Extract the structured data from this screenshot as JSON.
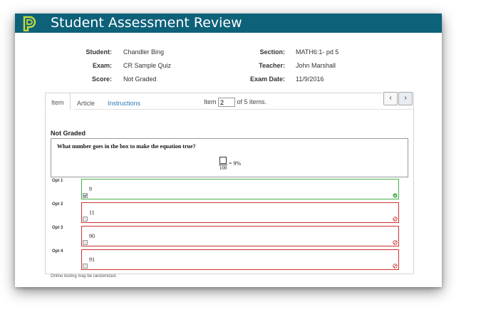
{
  "header": {
    "title": "Student Assessment Review"
  },
  "info": {
    "student_label": "Student:",
    "student": "Chandler Bing",
    "exam_label": "Exam:",
    "exam": "CR Sample Quiz",
    "score_label": "Score:",
    "score": "Not Graded",
    "section_label": "Section:",
    "section": "MATH6:1- pd 5",
    "teacher_label": "Teacher:",
    "teacher": "John Marshall",
    "date_label": "Exam Date:",
    "date": "11/9/2016"
  },
  "tabs": {
    "item": "Item",
    "article": "Article",
    "instructions": "Instructions"
  },
  "item_nav": {
    "prefix": "Item",
    "current": "2",
    "suffix": "of 5 items.",
    "prev": "‹",
    "next": "›"
  },
  "question": {
    "status": "Not Graded",
    "text": "What number goes in the box to make the equation true?",
    "equation_denominator": "100",
    "equation_rest": "= 9%"
  },
  "options": [
    {
      "label": "Opt 1",
      "value": "9",
      "correct": true
    },
    {
      "label": "Opt 2",
      "value": "11",
      "correct": false
    },
    {
      "label": "Opt 3",
      "value": "90",
      "correct": false
    },
    {
      "label": "Opt 4",
      "value": "91",
      "correct": false
    }
  ],
  "footer_note": "Online testing may be randomized.",
  "colors": {
    "header": "#0d6179",
    "correct": "#4caf50",
    "incorrect": "#cc3333",
    "link": "#2a7ab8"
  },
  "icons": {
    "logo": "powerschool-logo",
    "correct": "check-circle-icon",
    "incorrect": "no-entry-icon"
  }
}
